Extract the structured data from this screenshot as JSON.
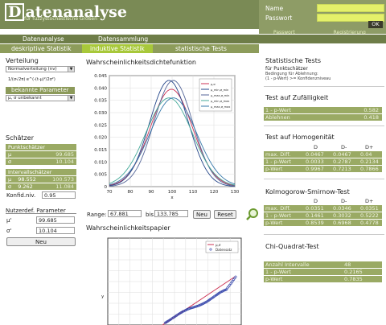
{
  "header": {
    "logo_text": "Datenanalyse",
    "logo_letter": "D",
    "logo_rest": "atenanalyse",
    "subtitle": "für fuzzystochastische Größen"
  },
  "login": {
    "name_label": "Name",
    "password_label": "Passwort",
    "ok_label": "OK",
    "link_left": "Passwort",
    "link_right": "Registrierung"
  },
  "nav": {
    "tab1": "Datenanalyse",
    "tab2": "Datensammlung",
    "sub1": "deskriptive Statistik",
    "sub2": "induktive Statistik",
    "sub3": "statistische Tests"
  },
  "verteilung": {
    "title": "Verteilung",
    "select_value": "Normalverteilung (nv)",
    "formula": "1/(σ√2π) e^(-(t-μ)²/2σ²)",
    "params_header": "bekannte Parameter",
    "param_select": "μ, σ unbekannt"
  },
  "schaetzer": {
    "title": "Schätzer",
    "punkt_label": "Punktschätzer",
    "punkt_mu": "99.685",
    "punkt_sigma": "10.104",
    "intervall_label": "Intervallschätzer",
    "int_low": "98.552",
    "int_high": "100.573",
    "int_sigma_low": "9.262",
    "int_sigma_high": "11.084",
    "konfniv_label": "Konfid.niv.",
    "konfniv_value": "0.95"
  },
  "nutzerdef": {
    "title": "Nutzerdef. Parameter",
    "mu_label": "μ'",
    "mu_value": "99.685",
    "sigma_label": "σ'",
    "sigma_value": "10.104",
    "button": "Neu"
  },
  "density": {
    "title": "Wahrscheinlichkeitsdichtefunktion",
    "range_label": "Range:",
    "range_from": "67.881",
    "bis_label": "bis",
    "range_to": "133.785",
    "neu_label": "Neu",
    "reset_label": "Reset",
    "legend": [
      "μ,σ",
      "μ_min,σ_min",
      "μ_max,σ_min",
      "μ_min,σ_max",
      "μ_max,σ_max"
    ],
    "xlabel": "x"
  },
  "prob_paper": {
    "title": "Wahrscheinlichkeitspapier",
    "legend": [
      "μ,σ",
      "Datensatz"
    ],
    "ylabel": "y"
  },
  "tests": {
    "title": "Statistische Tests",
    "sub": "für Punktschätzer",
    "cond1": "Bedingung für Ablehnung:",
    "cond2": "(1 - p-Wert) >= Konfidenzniveau"
  },
  "zufall": {
    "title": "Test auf Zufälligkeit",
    "rows": [
      {
        "label": "1 - p-Wert",
        "value": "0.582"
      },
      {
        "label": "Ablehnen",
        "value": "0.418"
      }
    ]
  },
  "homogen": {
    "title": "Test auf Homogenität",
    "cols": [
      "D",
      "D-",
      "D+"
    ],
    "rows": [
      {
        "label": "max. Diff.",
        "v": [
          "0.0467",
          "0.0467",
          "0.04"
        ]
      },
      {
        "label": "1 - p-Wert",
        "v": [
          "0.0033",
          "0.2787",
          "0.2134"
        ]
      },
      {
        "label": "p-Wert",
        "v": [
          "0.9967",
          "0.7213",
          "0.7866"
        ]
      }
    ]
  },
  "ks": {
    "title": "Kolmogorow-Smirnow-Test",
    "cols": [
      "D",
      "D-",
      "D+"
    ],
    "rows": [
      {
        "label": "max. Diff.",
        "v": [
          "0.0351",
          "0.0346",
          "0.0351"
        ]
      },
      {
        "label": "1 - p-Wert",
        "v": [
          "0.1461",
          "0.3032",
          "0.5222"
        ]
      },
      {
        "label": "p-Wert",
        "v": [
          "0.8539",
          "0.6968",
          "0.4778"
        ]
      }
    ]
  },
  "chi": {
    "title": "Chi-Quadrat-Test",
    "rows": [
      {
        "label": "Anzahl Intervalle",
        "value": "48"
      },
      {
        "label": "1 - p-Wert",
        "value": "0.2165"
      },
      {
        "label": "p-Wert",
        "value": "0.7835"
      }
    ]
  },
  "chart_data": {
    "type": "line",
    "xlabel": "x",
    "xlim": [
      70,
      130
    ],
    "ylim": [
      0,
      0.045
    ],
    "xticks": [
      "70",
      "80",
      "90",
      "100",
      "110",
      "120",
      "130"
    ],
    "yticks": [
      "0",
      "0.005",
      "0.010",
      "0.015",
      "0.020",
      "0.025",
      "0.030",
      "0.035",
      "0.040",
      "0.045"
    ],
    "series": [
      {
        "name": "μ,σ",
        "mu": 99.685,
        "sigma": 10.104
      },
      {
        "name": "μ_min,σ_min",
        "mu": 98.552,
        "sigma": 9.262
      },
      {
        "name": "μ_max,σ_min",
        "mu": 100.573,
        "sigma": 9.262
      },
      {
        "name": "μ_min,σ_max",
        "mu": 98.552,
        "sigma": 11.084
      },
      {
        "name": "μ_max,σ_max",
        "mu": 100.573,
        "sigma": 11.084
      }
    ]
  }
}
